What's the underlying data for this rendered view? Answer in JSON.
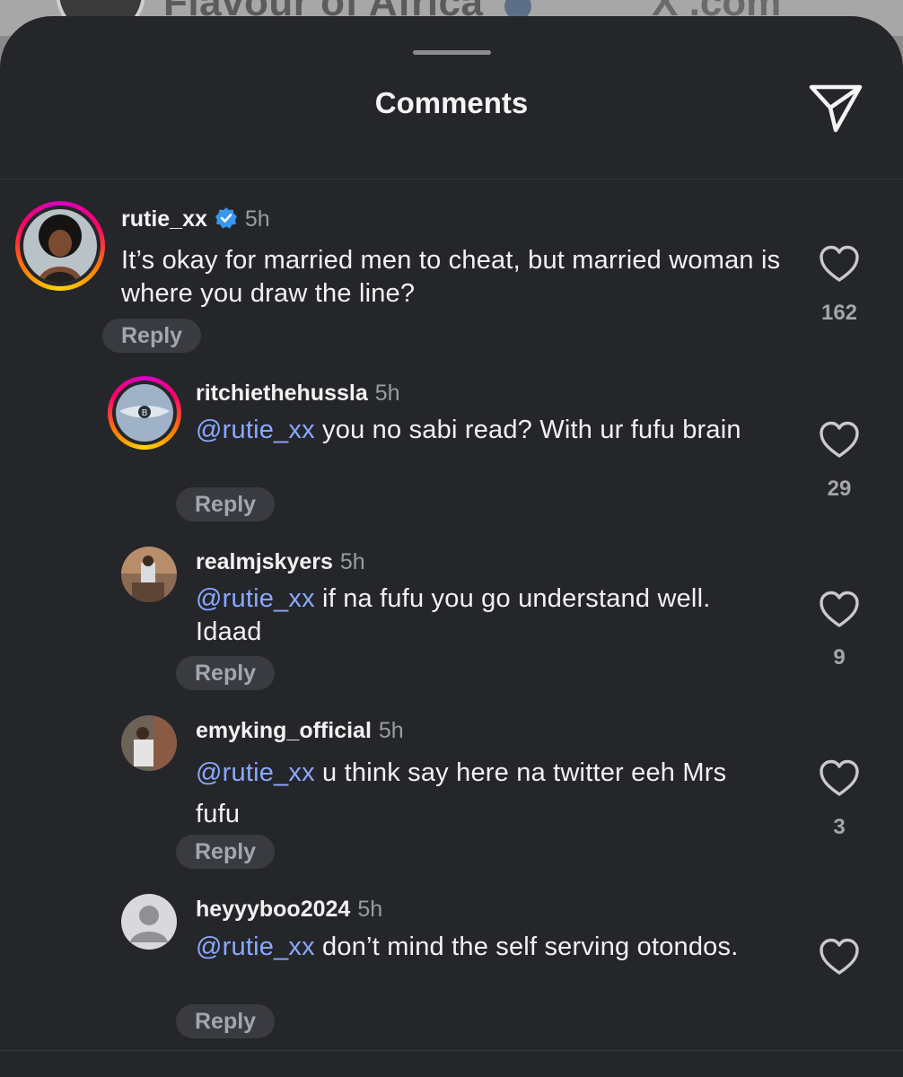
{
  "background_post": {
    "title": "Flavour of Africa",
    "platform": "X",
    "domain_suffix": ".com"
  },
  "sheet": {
    "title": "Comments",
    "share_icon": "paper-plane-icon"
  },
  "comments": [
    {
      "username": "rutie_xx",
      "verified": true,
      "time": "5h",
      "mention": "",
      "text": "It’s okay for married men to cheat, but married woman is where you draw the line?",
      "reply_label": "Reply",
      "likes": "162",
      "has_story_ring": true
    },
    {
      "username": "ritchiethehussla",
      "verified": false,
      "time": "5h",
      "mention": "@rutie_xx",
      "text": " you no sabi read? With ur fufu brain",
      "reply_label": "Reply",
      "likes": "29",
      "has_story_ring": true
    },
    {
      "username": "realmjskyers",
      "verified": false,
      "time": "5h",
      "mention": "@rutie_xx",
      "text": " if na fufu you go understand well. Idaad",
      "reply_label": "Reply",
      "likes": "9",
      "has_story_ring": false
    },
    {
      "username": "emyking_official",
      "verified": false,
      "time": "5h",
      "mention": "@rutie_xx",
      "text": " u think say here na twitter eeh Mrs fufu",
      "reply_label": "Reply",
      "likes": "3",
      "has_story_ring": false
    },
    {
      "username": "heyyyboo2024",
      "verified": false,
      "time": "5h",
      "mention": "@rutie_xx",
      "text": " don’t mind the self serving otondos.",
      "reply_label": "Reply",
      "likes": "",
      "has_story_ring": false
    }
  ],
  "colors": {
    "sheet_bg": "#25262a",
    "mention": "#8aa8ff",
    "verified_badge": "#3897f0"
  }
}
